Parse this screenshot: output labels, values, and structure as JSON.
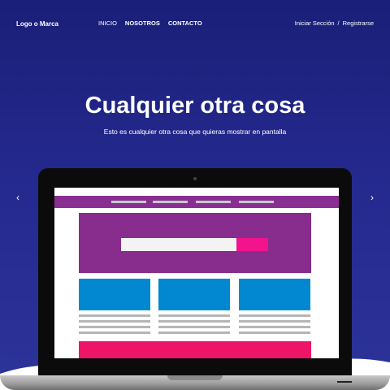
{
  "nav": {
    "logo": "Logo o Marca",
    "items": [
      {
        "label": "INICIO"
      },
      {
        "label": "NOSOTROS"
      },
      {
        "label": "CONTACTO"
      }
    ],
    "login": "Iniciar Sección",
    "separator": "/",
    "register": "Registrarse"
  },
  "hero": {
    "title": "Cualquier otra cosa",
    "subtitle": "Esto es cualquier otra cosa que quieras mostrar en pantalla"
  },
  "carousel": {
    "prev_icon": "‹",
    "next_icon": "›"
  },
  "colors": {
    "background_top": "#1a1f78",
    "background_bottom": "#2c3399",
    "mock_nav": "#8a2f92",
    "mock_hero": "#882d8d",
    "mock_button": "#f2148c",
    "mock_card": "#0288d1",
    "mock_footer": "#ee1468"
  }
}
